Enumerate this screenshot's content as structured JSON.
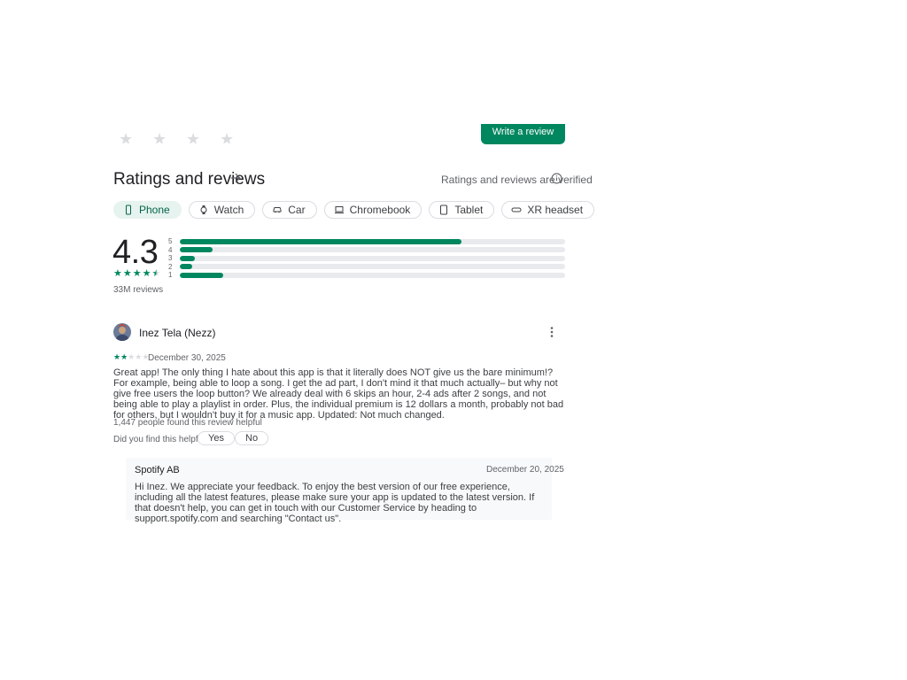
{
  "top": {
    "write_review_label": "Write a review"
  },
  "ratings": {
    "title": "Ratings and reviews",
    "verified_text": "Ratings and reviews are verified",
    "average": "4.3",
    "review_count": "33M reviews",
    "star_rating": 4.3,
    "distribution": [
      {
        "label": "5",
        "fraction": 0.73
      },
      {
        "label": "4",
        "fraction": 0.085
      },
      {
        "label": "3",
        "fraction": 0.04
      },
      {
        "label": "2",
        "fraction": 0.033
      },
      {
        "label": "1",
        "fraction": 0.113
      }
    ]
  },
  "devices": [
    {
      "label": "Phone",
      "icon": "phone-icon",
      "active": true
    },
    {
      "label": "Watch",
      "icon": "watch-icon",
      "active": false
    },
    {
      "label": "Car",
      "icon": "car-icon",
      "active": false
    },
    {
      "label": "Chromebook",
      "icon": "laptop-icon",
      "active": false
    },
    {
      "label": "Tablet",
      "icon": "tablet-icon",
      "active": false
    },
    {
      "label": "XR headset",
      "icon": "headset-icon",
      "active": false
    }
  ],
  "review": {
    "name": "Inez Tela (Nezz)",
    "stars": 2,
    "date": "December 30, 2025",
    "text": "Great app! The only thing I hate about this app is that it literally does NOT give us the bare minimum!? For example, being able to loop a song. I get the ad part, I don't mind it that much actually– but why not give free users the loop button? We already deal with 6 skips an hour, 2-4 ads after 2 songs, and not being able to play a playlist in order. Plus, the individual premium is 12 dollars a month, probably not bad for others, but I wouldn't buy it for a music app. Updated: Not much changed.",
    "helpful_count": "1,447 people found this review helpful",
    "helpful_question": "Did you find this helpful?",
    "yes_label": "Yes",
    "no_label": "No"
  },
  "reply": {
    "developer": "Spotify AB",
    "date": "December 20, 2025",
    "text": "Hi Inez. We appreciate your feedback. To enjoy the best version of our free experience, including all the latest features, please make sure your app is updated to the latest version. If that doesn't help, you can get in touch with our Customer Service by heading to support.spotify.com and searching \"Contact us\"."
  },
  "colors": {
    "accent": "#01875f",
    "chip_active_bg": "#e6f3ef",
    "star_empty": "#dadce0"
  }
}
